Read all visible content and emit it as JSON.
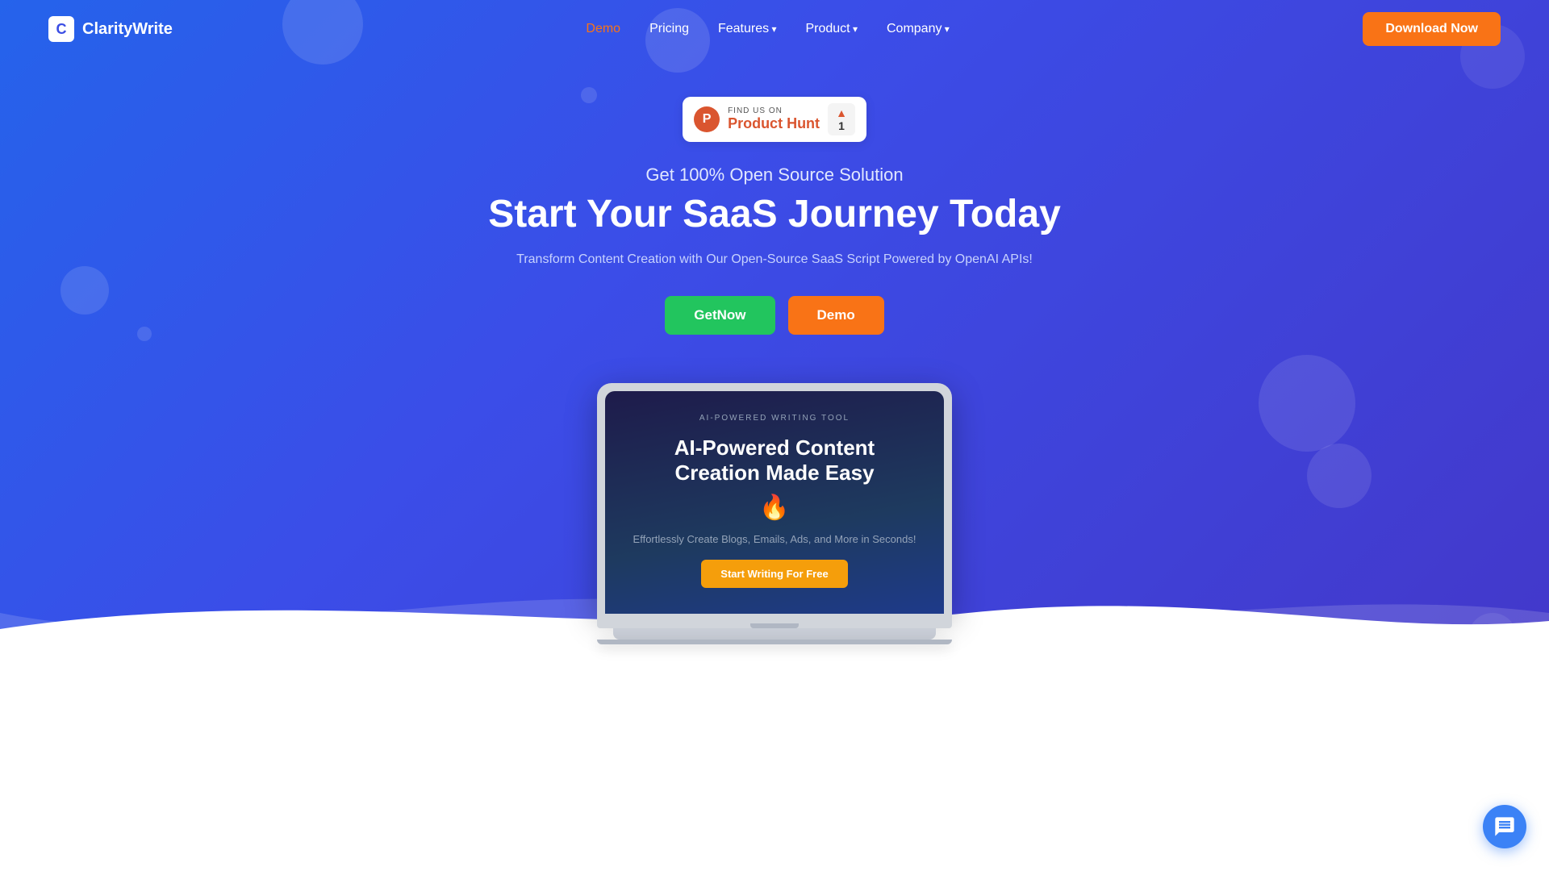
{
  "brand": {
    "logo_letter": "C",
    "name": "ClarityWrite"
  },
  "navbar": {
    "links": [
      {
        "label": "Demo",
        "active": true,
        "has_arrow": false
      },
      {
        "label": "Pricing",
        "active": false,
        "has_arrow": false
      },
      {
        "label": "Features",
        "active": false,
        "has_arrow": true
      },
      {
        "label": "Product",
        "active": false,
        "has_arrow": true
      },
      {
        "label": "Company",
        "active": false,
        "has_arrow": true
      }
    ],
    "cta_label": "Download Now"
  },
  "product_hunt": {
    "find_label": "FIND US ON",
    "name": "Product Hunt",
    "count": "1",
    "arrow": "▲"
  },
  "hero": {
    "subtitle": "Get 100% Open Source Solution",
    "title": "Start Your SaaS Journey Today",
    "description": "Transform Content Creation with Our Open-Source SaaS Script Powered by OpenAI APIs!",
    "btn_getnow": "GetNow",
    "btn_demo": "Demo"
  },
  "laptop_screen": {
    "tag": "AI-POWERED WRITING TOOL",
    "title_line1": "AI-Powered Content",
    "title_line2": "Creation Made Easy",
    "emoji": "🔥",
    "description": "Effortlessly Create Blogs, Emails, Ads, and More in Seconds!",
    "cta_label": "Start Writing For Free"
  },
  "chat": {
    "icon_label": "chat-icon"
  }
}
